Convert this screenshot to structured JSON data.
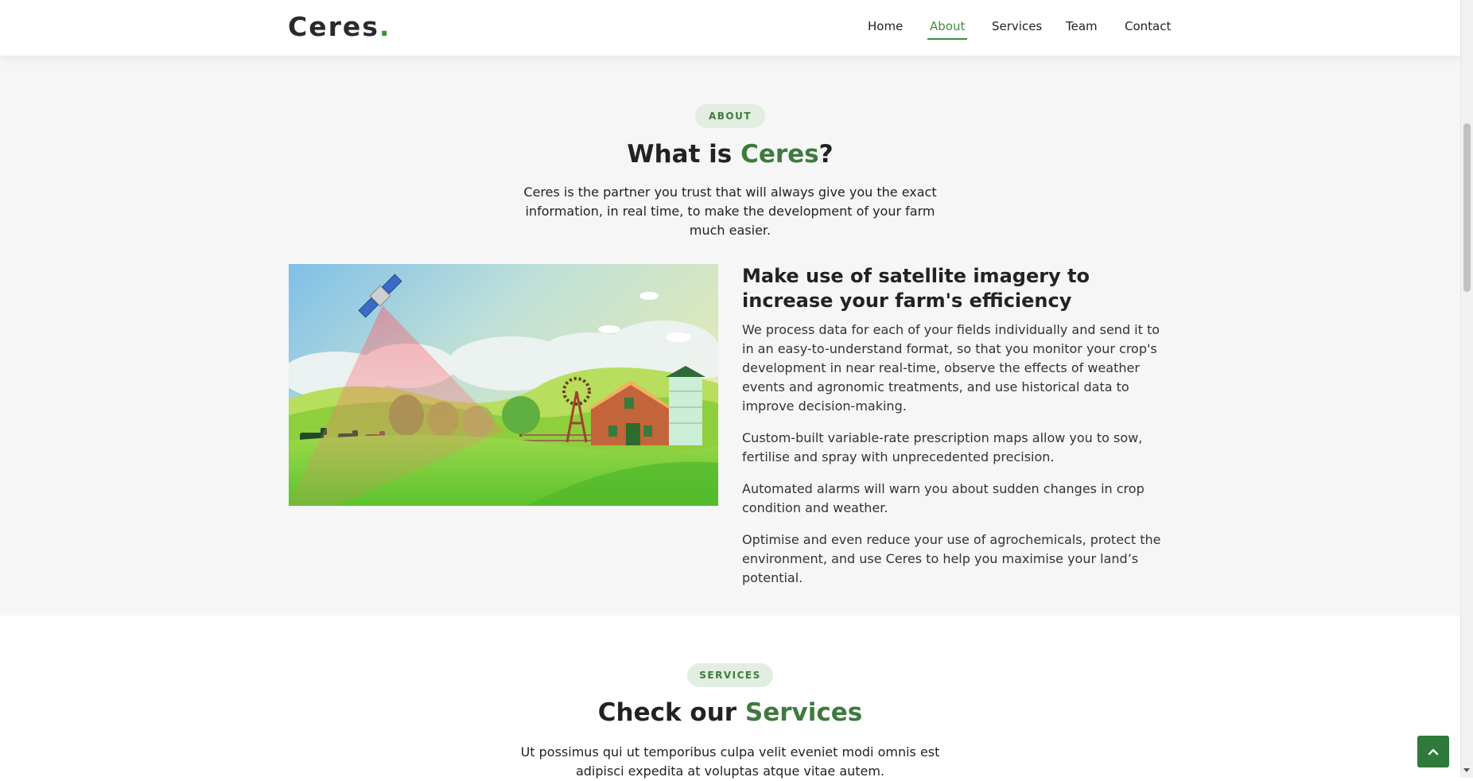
{
  "brand": {
    "name": "Ceres",
    "dot": ".",
    "accent_color": "#3e8e3e"
  },
  "nav": {
    "items": [
      {
        "label": "Home"
      },
      {
        "label": "About"
      },
      {
        "label": "Services"
      },
      {
        "label": "Team"
      },
      {
        "label": "Contact"
      }
    ],
    "active": "About"
  },
  "about": {
    "tag": "ABOUT",
    "title_prefix": "What is ",
    "title_accent": "Ceres",
    "title_suffix": "?",
    "lead": "Ceres is the partner you trust that will always give you the exact information, in real time, to make the development of your farm much easier.",
    "heading": "Make use of satellite imagery to increase your farm's efficiency",
    "paragraphs": [
      "We process data for each of your fields individually and send it to in an easy-to-understand format, so that you monitor your crop's development in near real-time, observe the effects of weather events and agronomic treatments, and use historical data to improve decision-making.",
      "Custom-built variable-rate prescription maps allow you to sow, fertilise and spray with unprecedented precision.",
      "Automated alarms will warn you about sudden changes in crop condition and weather.",
      "Optimise and even reduce your use of agrochemicals, protect the environment, and use Ceres to help you maximise your land’s potential."
    ]
  },
  "services": {
    "tag": "SERVICES",
    "title_prefix": "Check our ",
    "title_accent": "Services",
    "lead": "Ut possimus qui ut temporibus culpa velit eveniet modi omnis est adipisci expedita at voluptas atque vitae autem."
  },
  "icons": {
    "back_to_top": "chevron-up-icon",
    "illustration": "satellite-farm-illustration"
  },
  "colors": {
    "accent": "#3e7a3e",
    "pill_bg": "#e2eee1",
    "about_bg": "#f6f6f6",
    "back_to_top_bg": "#2f7a3a"
  }
}
